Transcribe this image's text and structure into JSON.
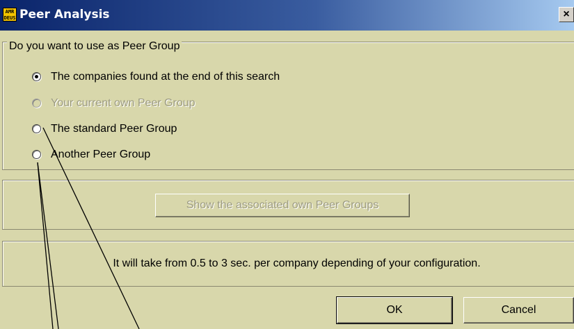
{
  "window": {
    "title": "Peer Analysis",
    "icon_text": "AMR\nDEUS",
    "icon": "app-logo-icon",
    "close_label": "×"
  },
  "peer_group": {
    "legend": "Do you want to use as Peer Group",
    "options": [
      {
        "label": "The companies found at the end of this search",
        "selected": true,
        "enabled": true
      },
      {
        "label": "Your current own Peer Group",
        "selected": false,
        "enabled": false
      },
      {
        "label": "The standard Peer Group",
        "selected": false,
        "enabled": true
      },
      {
        "label": "Another Peer Group",
        "selected": false,
        "enabled": true
      }
    ]
  },
  "show_button": {
    "label": "Show the associated own Peer Groups",
    "enabled": false
  },
  "info": {
    "text": "It will take from 0.5 to 3 sec. per company depending of your configuration."
  },
  "buttons": {
    "ok": "OK",
    "cancel": "Cancel"
  },
  "colors": {
    "dialog_bg": "#d8d7ab",
    "titlebar": "#0a246a",
    "disabled_text": "#9c9b80"
  }
}
